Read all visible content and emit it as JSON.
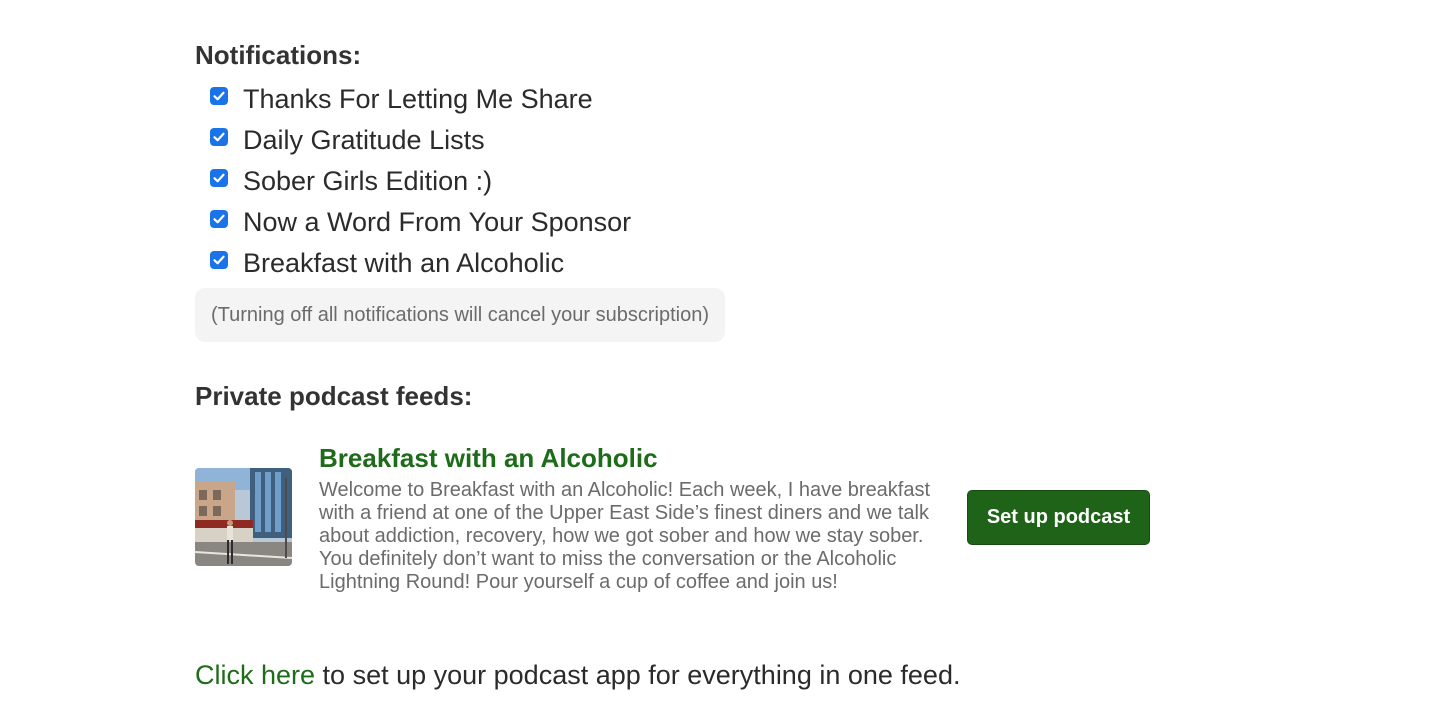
{
  "notifications": {
    "heading": "Notifications:",
    "items": [
      {
        "label": "Thanks For Letting Me Share",
        "checked": true
      },
      {
        "label": "Daily Gratitude Lists",
        "checked": true
      },
      {
        "label": "Sober Girls Edition :)",
        "checked": true
      },
      {
        "label": "Now a Word From Your Sponsor",
        "checked": true
      },
      {
        "label": "Breakfast with an Alcoholic",
        "checked": true
      }
    ],
    "notice": "(Turning off all notifications will cancel your subscription)"
  },
  "podcasts": {
    "heading": "Private podcast feeds:",
    "feed": {
      "title": "Breakfast with an Alcoholic",
      "description": "Welcome to Breakfast with an Alcoholic! Each week, I have breakfast with a friend at one of the Upper East Side’s finest diners and we talk about addiction, recovery, how we got sober and how we stay sober. You definitely don’t want to miss the conversation or the Alcoholic Lightning Round! Pour yourself a cup of coffee and join us!",
      "button_label": "Set up podcast"
    }
  },
  "footer": {
    "link_text": "Click here",
    "rest_text": " to set up your podcast app for everything in one feed."
  },
  "colors": {
    "accent_green": "#1e6b1a",
    "button_green": "#1f6319",
    "checkbox_blue": "#1a73e8"
  },
  "icons": {
    "checkbox": "checkmark-icon"
  }
}
